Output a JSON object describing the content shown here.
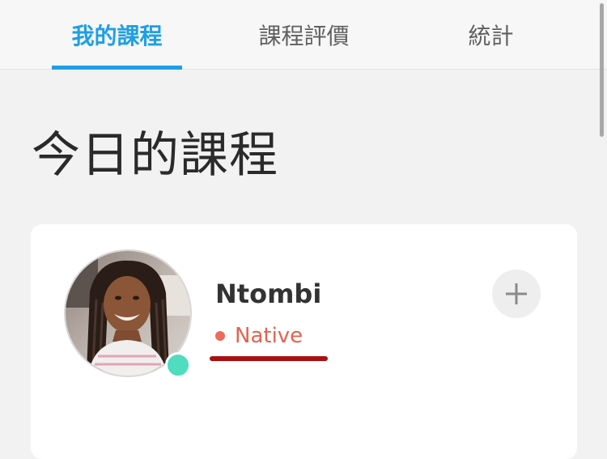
{
  "tabs": [
    {
      "label": "我的課程",
      "active": true
    },
    {
      "label": "課程評價",
      "active": false
    },
    {
      "label": "統計",
      "active": false
    }
  ],
  "section_title": "今日的課程",
  "tutor": {
    "name": "Ntombi",
    "tag": "Native",
    "online": true,
    "avatar_icon": "avatar-photo",
    "add_icon": "plus-icon"
  },
  "colors": {
    "accent": "#1e9fe6",
    "online": "#4fdcbf",
    "native": "#e4624f",
    "underline_mark": "#a90f12"
  }
}
